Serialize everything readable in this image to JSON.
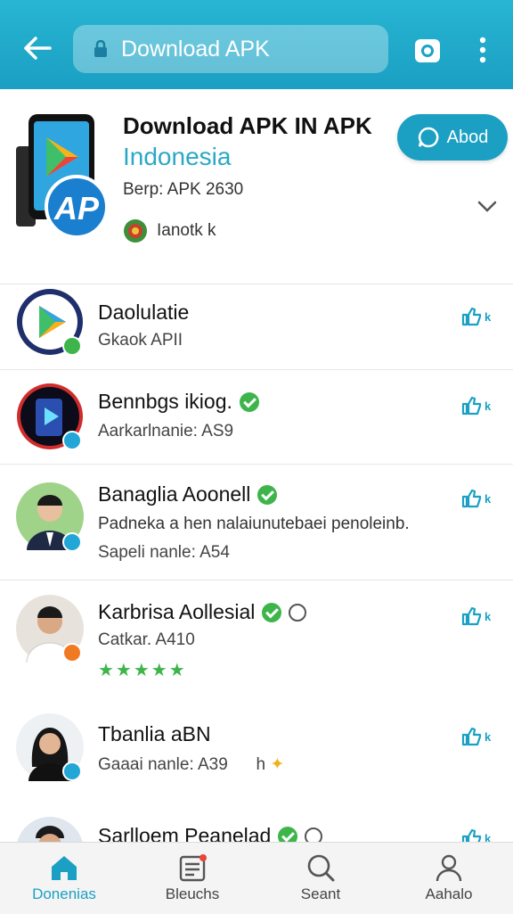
{
  "topbar": {
    "search_text": "Download APK",
    "back_icon": "arrow-left-icon",
    "lock_icon": "lock-icon",
    "camera_icon": "camera-icon",
    "more_icon": "more-vertical-icon"
  },
  "app_header": {
    "title_line1": "Download APK IN APK",
    "title_line2": "Indonesia",
    "meta": "Berp: APK 2630",
    "developer": "Ianotk k",
    "about_label": "Abod",
    "accent_color": "#1ba0c3"
  },
  "list": [
    {
      "name": "Daolulatie",
      "subtitle": "Gkaok APII",
      "badge": ""
    },
    {
      "name": "Bennbgs ikiog.",
      "subtitle": "Aarkarlnanie: AS9",
      "badge": "verified"
    },
    {
      "name": "Banaglia Aoonell",
      "subtitle": "Padneka a hen nalaiunutebaei penoleinb.",
      "subtitle2": "Sapeli nanle: A54",
      "badge": "verified"
    },
    {
      "name": "Karbrisa Aollesial",
      "subtitle": "Catkar. A410",
      "rating": "★★★★★",
      "badge": "verified"
    },
    {
      "name": "Tbanlia aBN",
      "subtitle": "Gaaai nanle: A39",
      "suffix": "h",
      "badge": ""
    },
    {
      "name": "Sarlloem Peanelad",
      "subtitle": "",
      "badge": "verified"
    }
  ],
  "bottom_nav": [
    {
      "label": "Donenias",
      "icon": "home-icon",
      "active": true
    },
    {
      "label": "Bleuchs",
      "icon": "news-icon",
      "active": false
    },
    {
      "label": "Seant",
      "icon": "search-icon",
      "active": false
    },
    {
      "label": "Aahalo",
      "icon": "profile-icon",
      "active": false
    }
  ]
}
